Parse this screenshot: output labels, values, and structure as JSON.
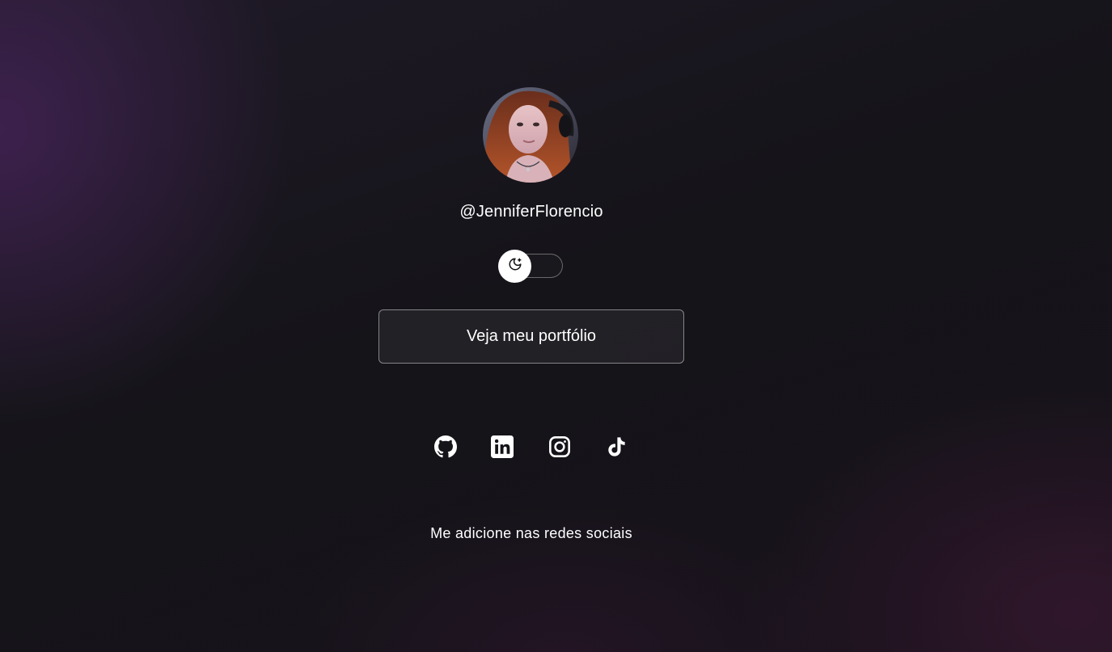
{
  "profile": {
    "username": "@JenniferFlorencio",
    "avatar": "profile-photo"
  },
  "theme_toggle": {
    "icon": "moon-stars-icon",
    "state": "dark"
  },
  "portfolio_button": {
    "label": "Veja meu portfólio"
  },
  "social_links": [
    {
      "name": "GitHub",
      "icon": "github-icon"
    },
    {
      "name": "LinkedIn",
      "icon": "linkedin-icon"
    },
    {
      "name": "Instagram",
      "icon": "instagram-icon"
    },
    {
      "name": "TikTok",
      "icon": "tiktok-icon"
    }
  ],
  "footer": {
    "text": "Me adicione nas redes sociais"
  },
  "colors": {
    "background": "#151419",
    "accent_glow": "#582870",
    "text": "#ffffff"
  }
}
